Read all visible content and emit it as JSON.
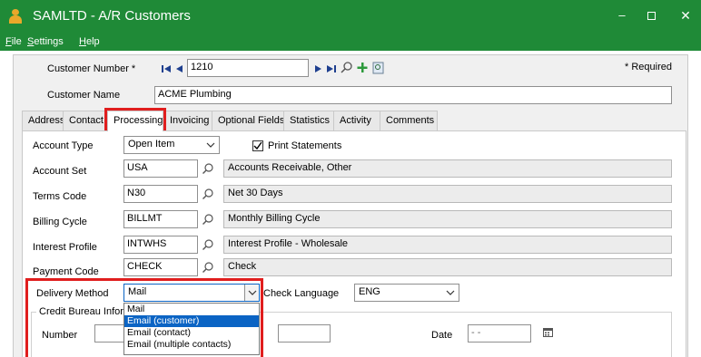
{
  "window": {
    "title": "SAMLTD - A/R Customers",
    "controls": {
      "minimize": "–",
      "maximize": "□",
      "close": "✕"
    }
  },
  "menu": {
    "items": [
      {
        "label": "File",
        "hotkey": "F",
        "rest": "ile"
      },
      {
        "label": "Settings",
        "hotkey": "S",
        "rest": "ettings"
      },
      {
        "label": "Help",
        "hotkey": "H",
        "rest": "elp"
      }
    ]
  },
  "header": {
    "customer_number_label": "Customer Number *",
    "customer_number_value": "1210",
    "required_note": "* Required",
    "customer_name_label": "Customer Name",
    "customer_name_value": "ACME Plumbing"
  },
  "tabs": [
    {
      "label": "Address",
      "active": false
    },
    {
      "label": "Contact",
      "active": false
    },
    {
      "label": "Processing",
      "active": true
    },
    {
      "label": "Invoicing",
      "active": false
    },
    {
      "label": "Optional Fields",
      "active": false
    },
    {
      "label": "Statistics",
      "active": false
    },
    {
      "label": "Activity",
      "active": false
    },
    {
      "label": "Comments",
      "active": false
    }
  ],
  "processing": {
    "account_type": {
      "label": "Account Type",
      "value": "Open Item"
    },
    "print_statements": {
      "label": "Print Statements",
      "checked": true
    },
    "account_set": {
      "label": "Account Set",
      "code": "USA",
      "description": "Accounts Receivable, Other"
    },
    "terms_code": {
      "label": "Terms Code",
      "code": "N30",
      "description": "Net 30 Days"
    },
    "billing_cycle": {
      "label": "Billing Cycle",
      "code": "BILLMT",
      "description": "Monthly Billing Cycle"
    },
    "interest_profile": {
      "label": "Interest Profile",
      "code": "INTWHS",
      "description": "Interest Profile - Wholesale"
    },
    "payment_code": {
      "label": "Payment Code",
      "code": "CHECK",
      "description": "Check"
    },
    "delivery_method": {
      "label": "Delivery Method",
      "value": "Mail",
      "options": [
        "Mail",
        "Email (customer)",
        "Email (contact)",
        "Email (multiple contacts)"
      ],
      "highlighted": "Email (customer)"
    },
    "check_language": {
      "label": "Check Language",
      "value": "ENG"
    },
    "credit_bureau": {
      "group_label": "Credit Bureau Informa",
      "number_label": "Number",
      "date_label": "Date",
      "date_value": "- -"
    }
  },
  "colors": {
    "titlebar": "#1f8a37",
    "highlight_box": "#e01e1e",
    "selection": "#0b64c4"
  }
}
